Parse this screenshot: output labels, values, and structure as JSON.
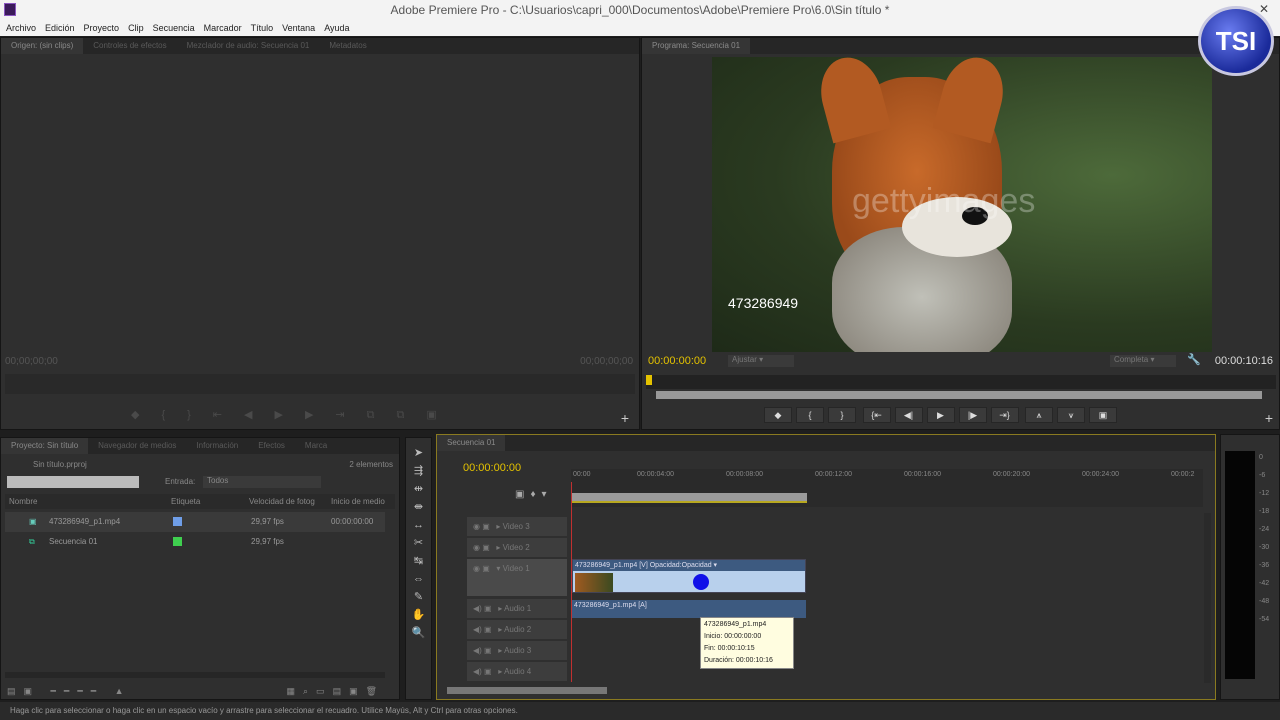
{
  "window": {
    "title": "Adobe Premiere Pro - C:\\Usuarios\\capri_000\\Documentos\\Adobe\\Premiere Pro\\6.0\\Sin título *",
    "logo": "TSI"
  },
  "menu": [
    "Archivo",
    "Edición",
    "Proyecto",
    "Clip",
    "Secuencia",
    "Marcador",
    "Título",
    "Ventana",
    "Ayuda"
  ],
  "source": {
    "tabs": [
      "Origen: (sin clips)",
      "Controles de efectos",
      "Mezclador de audio: Secuencia 01",
      "Metadatos"
    ],
    "tc_left": "00;00;00;00",
    "tc_right": "00;00;00;00"
  },
  "program": {
    "tab": "Programa: Secuencia 01",
    "tc_current": "00:00:00:00",
    "fit": "Ajustar",
    "quality": "Completa",
    "tc_duration": "00:00:10:16",
    "watermark_id": "473286949",
    "watermark_brand": "gettyimages"
  },
  "project": {
    "tabs": [
      "Proyecto: Sin título",
      "Navegador de medios",
      "Información",
      "Efectos",
      "Marca"
    ],
    "file": "Sin título.prproj",
    "count": "2 elementos",
    "search": "",
    "entrada_label": "Entrada:",
    "entrada_value": "Todos",
    "columns": [
      "Nombre",
      "Etiqueta",
      "Velocidad de fotog",
      "Inicio de medio"
    ],
    "items": [
      {
        "name": "473286949_p1.mp4",
        "label_color": "#6f9ee8",
        "fps": "29,97 fps",
        "start": "00:00:00:00"
      },
      {
        "name": "Secuencia 01",
        "label_color": "#3fcf4f",
        "fps": "29,97 fps",
        "start": ""
      }
    ]
  },
  "timeline": {
    "tab": "Secuencia 01",
    "tc": "00:00:00:00",
    "ruler": [
      "00:00",
      "00:00:04:00",
      "00:00:08:00",
      "00:00:12:00",
      "00:00:16:00",
      "00:00:20:00",
      "00:00:24:00",
      "00:00:2"
    ],
    "tracks": [
      "Video 3",
      "Video 2",
      "Video 1",
      "Audio 1",
      "Audio 2",
      "Audio 3",
      "Audio 4"
    ],
    "video_clip": "473286949_p1.mp4 [V]  Opacidad:Opacidad ▾",
    "audio_clip": "473286949_p1.mp4 [A]",
    "tooltip": [
      "473286949_p1.mp4",
      "Inicio: 00:00:00:00",
      "Fin: 00:00:10:15",
      "Duración: 00:00:10:16"
    ]
  },
  "meters": [
    "0",
    "-6",
    "-12",
    "-18",
    "-24",
    "-30",
    "-36",
    "-42",
    "-48",
    "-54"
  ],
  "status": "Haga clic para seleccionar o haga clic en un espacio vacío y arrastre para seleccionar el recuadro. Utilice Mayús, Alt y Ctrl para otras opciones."
}
